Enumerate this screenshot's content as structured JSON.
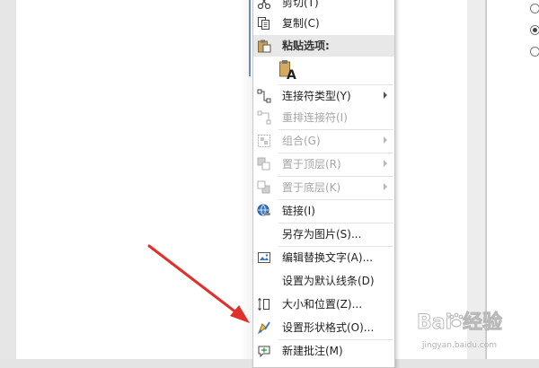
{
  "menu": {
    "cut_label": "剪切(T)",
    "copy_label": "复制(C)",
    "paste_options_label": "粘贴选项:",
    "connector_type_label": "连接符类型(Y)",
    "reroute_label": "重排连接符(I)",
    "group_label": "组合(G)",
    "bring_front_label": "置于顶层(R)",
    "send_back_label": "置于底层(K)",
    "link_label": "链接(I)",
    "save_picture_label": "另存为图片(S)...",
    "alt_text_label": "编辑替换文字(A)...",
    "default_line_label": "设置为默认线条(D)",
    "size_position_label": "大小和位置(Z)...",
    "format_shape_label": "设置形状格式(O)...",
    "new_comment_label": "新建批注(M)"
  },
  "watermark": {
    "brand": "Baidu经验",
    "url": "jingyan.baidu.com"
  },
  "colors": {
    "arrow": "#e0302a",
    "icon_blue": "#2f6fbf",
    "disabled_text": "#a6a6a6"
  }
}
